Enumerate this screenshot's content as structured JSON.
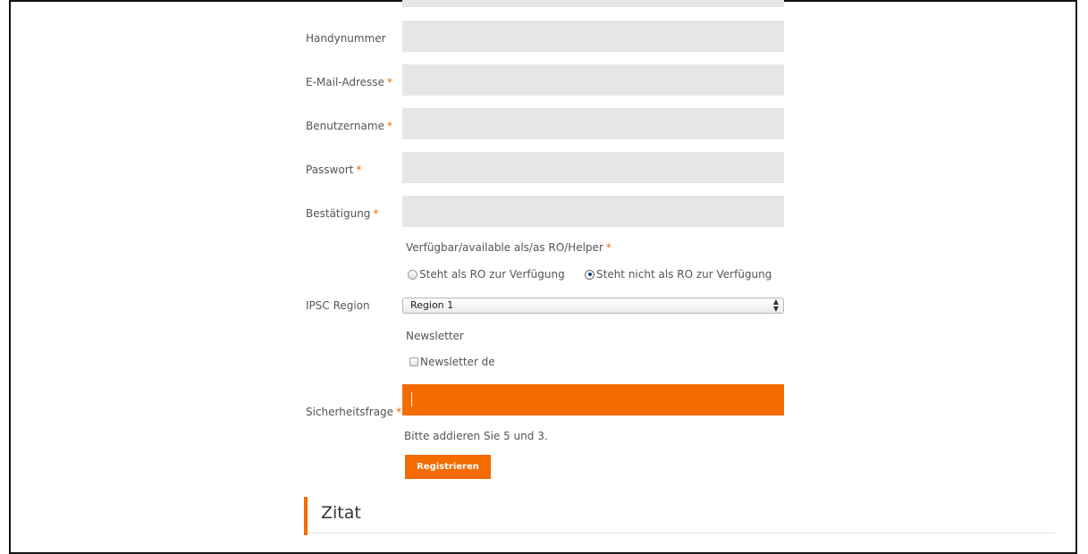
{
  "form": {
    "required_mark": "*",
    "fields": [
      {
        "label": "Handynummer",
        "required": false,
        "value": ""
      },
      {
        "label": "E-Mail-Adresse",
        "required": true,
        "value": ""
      },
      {
        "label": "Benutzername",
        "required": true,
        "value": ""
      },
      {
        "label": "Passwort",
        "required": true,
        "value": ""
      },
      {
        "label": "Bestätigung",
        "required": true,
        "value": ""
      }
    ],
    "availability": {
      "label": "Verfügbar/available als/as RO/Helper",
      "required": true,
      "options": [
        {
          "label": "Steht als RO zur Verfügung",
          "checked": false
        },
        {
          "label": "Steht nicht als RO zur Verfügung",
          "checked": true
        }
      ]
    },
    "region": {
      "label": "IPSC Region",
      "selected": "Region 1"
    },
    "newsletter": {
      "label": "Newsletter",
      "option_label": "Newsletter de",
      "checked": false
    },
    "security": {
      "label": "Sicherheitsfrage",
      "required": true,
      "value": "",
      "hint": "Bitte addieren Sie 5 und 3."
    },
    "submit_label": "Registrieren"
  },
  "quote_section": {
    "title": "Zitat"
  },
  "colors": {
    "accent": "#f46b00",
    "field_bg": "#e6e6e6",
    "text": "#555555"
  }
}
